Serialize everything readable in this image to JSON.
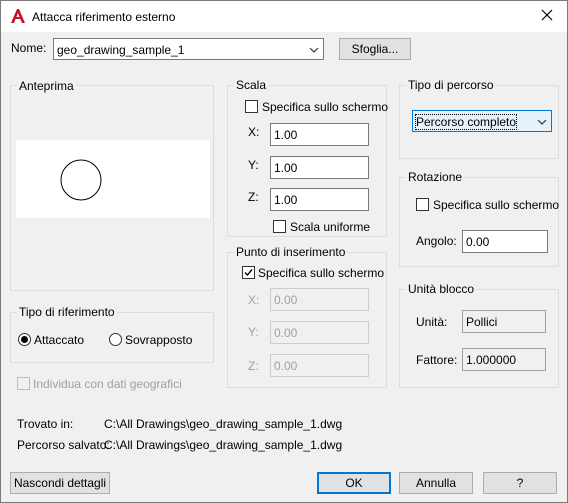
{
  "window": {
    "title": "Attacca riferimento esterno"
  },
  "name_row": {
    "label": "Nome:",
    "value": "geo_drawing_sample_1",
    "browse_button": "Sfoglia..."
  },
  "preview": {
    "title": "Anteprima"
  },
  "reference_type": {
    "title": "Tipo di riferimento",
    "options": [
      "Attaccato",
      "Sovrapposto"
    ],
    "selected": "Attaccato"
  },
  "geo": {
    "label": "Individua con dati geografici"
  },
  "scale": {
    "title": "Scala",
    "specify_on_screen": "Specifica sullo schermo",
    "x_label": "X:",
    "x_value": "1.00",
    "y_label": "Y:",
    "y_value": "1.00",
    "z_label": "Z:",
    "z_value": "1.00",
    "uniform": "Scala uniforme"
  },
  "insertion": {
    "title": "Punto di inserimento",
    "specify_on_screen": "Specifica sullo schermo",
    "x_label": "X:",
    "x_value": "0.00",
    "y_label": "Y:",
    "y_value": "0.00",
    "z_label": "Z:",
    "z_value": "0.00"
  },
  "path_type": {
    "title": "Tipo di percorso",
    "value": "Percorso completo"
  },
  "rotation": {
    "title": "Rotazione",
    "specify_on_screen": "Specifica sullo schermo",
    "angle_label": "Angolo:",
    "angle_value": "0.00"
  },
  "block_unit": {
    "title": "Unità blocco",
    "unit_label": "Unità:",
    "unit_value": "Pollici",
    "factor_label": "Fattore:",
    "factor_value": "1.000000"
  },
  "details": {
    "found_label": "Trovato in:",
    "found_value": "C:\\All Drawings\\geo_drawing_sample_1.dwg",
    "saved_label": "Percorso salvato:",
    "saved_value": "C:\\All Drawings\\geo_drawing_sample_1.dwg"
  },
  "footer": {
    "hide_details": "Nascondi dettagli",
    "ok": "OK",
    "cancel": "Annulla",
    "help": "?"
  },
  "colors": {
    "accent": "#0078d7",
    "app_icon": "#c8102e"
  }
}
